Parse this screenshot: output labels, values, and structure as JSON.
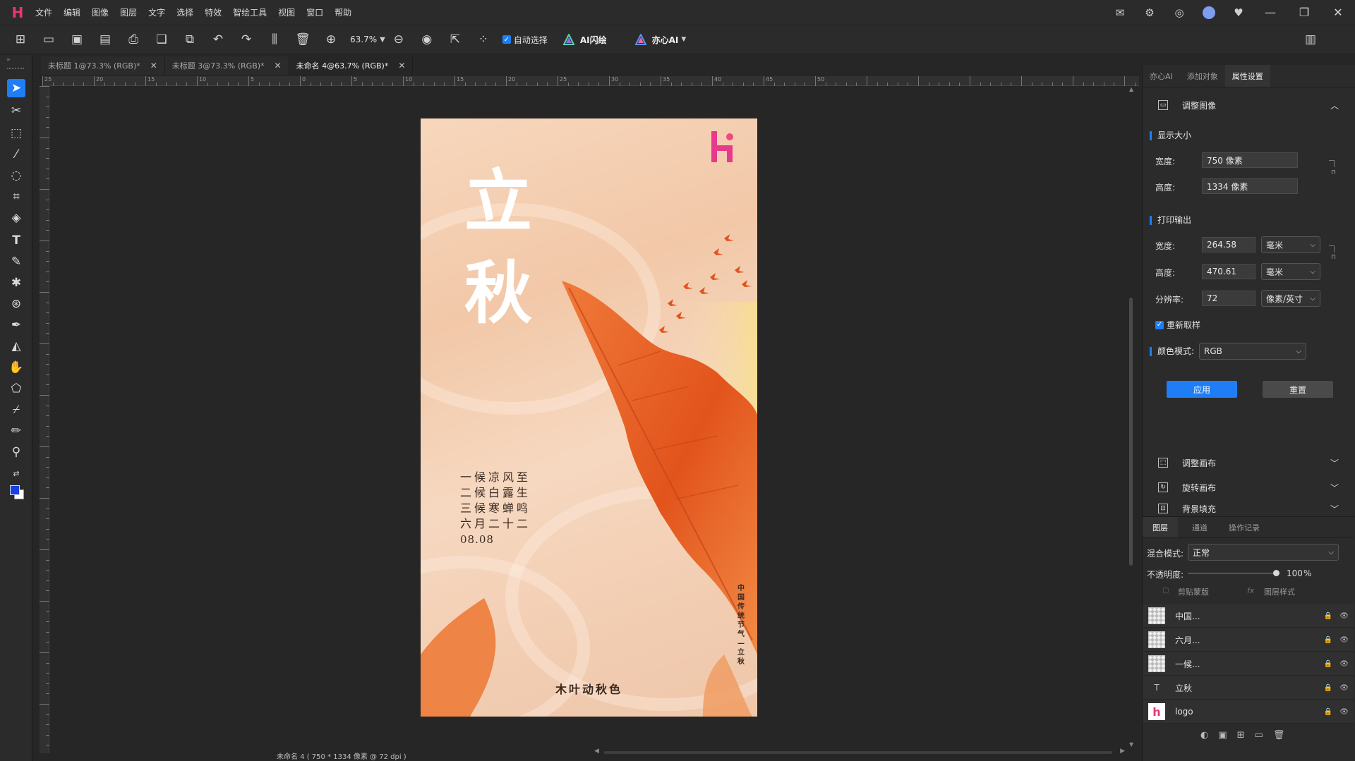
{
  "menubar": {
    "items": [
      "文件",
      "编辑",
      "图像",
      "图层",
      "文字",
      "选择",
      "特效",
      "智绘工具",
      "视图",
      "窗口",
      "帮助"
    ]
  },
  "toolbar": {
    "zoom": "63.7%",
    "auto_select_label": "自动选择",
    "ai_flash_label": "AI闪绘",
    "yixin_label": "亦心AI"
  },
  "tabs": [
    {
      "label": "未标题 1@73.3% (RGB)*"
    },
    {
      "label": "未标题 3@73.3% (RGB)*"
    },
    {
      "label": "未命名 4@63.7% (RGB)*"
    }
  ],
  "ruler_ticks": [
    "25",
    "20",
    "15",
    "10",
    "5",
    "0",
    "5",
    "10",
    "15",
    "20",
    "25",
    "30",
    "35",
    "40",
    "45",
    "50"
  ],
  "status": "未命名 4 ( 750 * 1334 像素 @ 72 dpi )",
  "poster": {
    "title_1": "立",
    "title_2": "秋",
    "poem": [
      "一候凉风至",
      "二候白露生",
      "三候寒蝉鸣",
      "六月二十二",
      "08.08"
    ],
    "vertical": "中国传统节气—立秋",
    "bottom": "木叶动秋色"
  },
  "rightpanel": {
    "tabs": [
      "亦心AI",
      "添加对象",
      "属性设置"
    ],
    "adjust_image": "调整图像",
    "display_size": "显示大小",
    "width_label": "宽度:",
    "height_label": "高度:",
    "display_width": "750 像素",
    "display_height": "1334 像素",
    "print_output": "打印输出",
    "print_width": "264.58",
    "print_height": "470.61",
    "unit_mm": "毫米",
    "resolution_label": "分辨率:",
    "resolution": "72",
    "resolution_unit": "像素/英寸",
    "resample_label": "重新取样",
    "color_mode_label": "颜色模式:",
    "color_mode": "RGB",
    "apply": "应用",
    "reset": "重置",
    "adjust_canvas": "调整画布",
    "rotate_canvas": "旋转画布",
    "bg_fill": "背景填充"
  },
  "layers_panel": {
    "tabs": [
      "图层",
      "通道",
      "操作记录"
    ],
    "blend_label": "混合模式:",
    "blend_value": "正常",
    "opacity_label": "不透明度:",
    "opacity_value": "100",
    "opacity_unit": "%",
    "opacity": 1.0,
    "clip_mask": "剪贴蒙版",
    "layer_style": "图层样式",
    "layers": [
      "中国...",
      "六月...",
      "一候...",
      "立秋",
      "logo"
    ]
  },
  "colors": {
    "accent": "#1f7ef5",
    "logo": "#e8357a"
  }
}
